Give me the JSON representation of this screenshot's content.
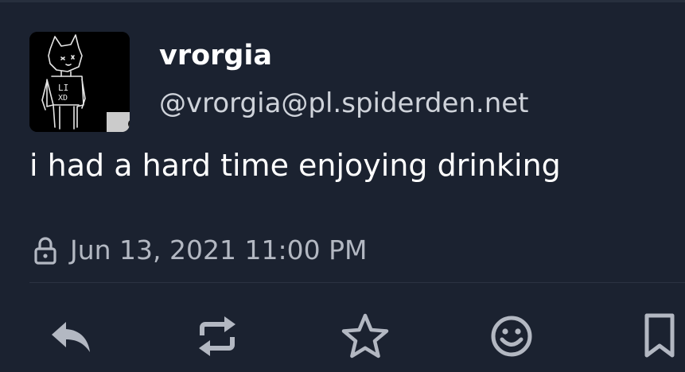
{
  "status": {
    "display_name": "vrorgia",
    "handle": "@vrorgia@pl.spiderden.net",
    "content": "i had a hard time enjoying drinking",
    "visibility_icon": "lock-icon",
    "timestamp": "Jun 13, 2021 11:00 PM",
    "avatar": {
      "image": "drawing-of-cat-character",
      "badge_icon": "robot-icon",
      "avatar_lettering": "LI XD"
    }
  },
  "actions": [
    {
      "name": "reply",
      "icon": "reply-icon"
    },
    {
      "name": "boost",
      "icon": "repeat-icon"
    },
    {
      "name": "favourite",
      "icon": "star-icon"
    },
    {
      "name": "react",
      "icon": "smiley-icon"
    },
    {
      "name": "bookmark",
      "icon": "bookmark-icon"
    }
  ],
  "colors": {
    "background": "#1b2230",
    "text_primary": "#ffffff",
    "text_secondary": "#b3b8c2",
    "icon": "#b3b8c2"
  }
}
